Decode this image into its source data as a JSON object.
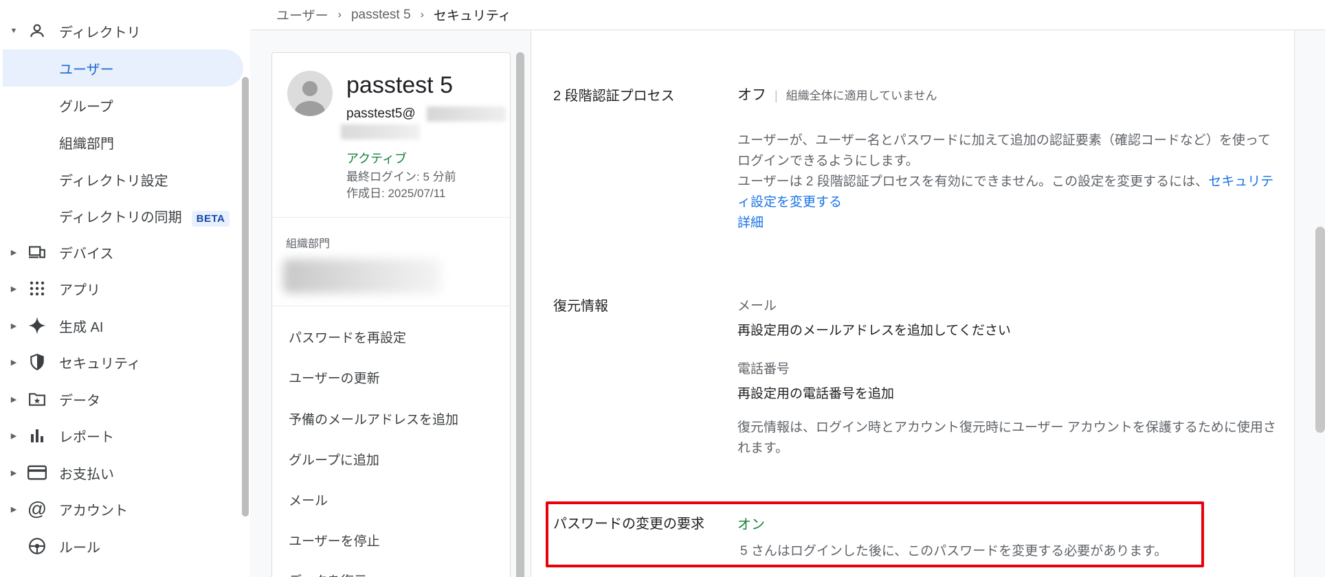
{
  "breadcrumb": {
    "items": [
      "ユーザー",
      "passtest 5",
      "セキュリティ"
    ]
  },
  "sidebar": {
    "directory": {
      "label": "ディレクトリ",
      "icon": "person-icon",
      "children": [
        {
          "label": "ユーザー",
          "active": true
        },
        {
          "label": "グループ"
        },
        {
          "label": "組織部門"
        },
        {
          "label": "ディレクトリ設定"
        },
        {
          "label": "ディレクトリの同期",
          "badge": "BETA"
        }
      ]
    },
    "items": [
      {
        "label": "デバイス",
        "icon": "devices-icon"
      },
      {
        "label": "アプリ",
        "icon": "apps-grid-icon"
      },
      {
        "label": "生成 AI",
        "icon": "sparkle-icon"
      },
      {
        "label": "セキュリティ",
        "icon": "shield-icon"
      },
      {
        "label": "データ",
        "icon": "folder-star-icon"
      },
      {
        "label": "レポート",
        "icon": "bar-chart-icon"
      },
      {
        "label": "お支払い",
        "icon": "credit-card-icon"
      },
      {
        "label": "アカウント",
        "icon": "at-sign-icon"
      },
      {
        "label": "ルール",
        "icon": "rules-icon"
      }
    ]
  },
  "user_card": {
    "name": "passtest 5",
    "email": "passtest5@",
    "status": "アクティブ",
    "last_login": "最終ログイン: 5 分前",
    "created": "作成日: 2025/07/11",
    "org_unit_label": "組織部門",
    "actions": [
      "パスワードを再設定",
      "ユーザーの更新",
      "予備のメールアドレスを追加",
      "グループに追加",
      "メール",
      "ユーザーを停止",
      "データを復元"
    ]
  },
  "security": {
    "two_step": {
      "label": "2 段階認証プロセス",
      "status": "オフ",
      "note": "組織全体に適用していません",
      "desc1": "ユーザーが、ユーザー名とパスワードに加えて追加の認証要素（確認コードなど）を使ってログインできるようにします。",
      "desc2": "ユーザーは 2 段階認証プロセスを有効にできません。この設定を変更するには、",
      "link_settings": "セキュリティ設定を変更する",
      "link_details": "詳細"
    },
    "recovery": {
      "label": "復元情報",
      "email_label": "メール",
      "email_value": "再設定用のメールアドレスを追加してください",
      "phone_label": "電話番号",
      "phone_value": "再設定用の電話番号を追加",
      "desc": "復元情報は、ログイン時とアカウント復元時にユーザー アカウントを保護するために使用されます。"
    },
    "password_change": {
      "label": "パスワードの変更の要求",
      "status": "オン",
      "desc": "5 さんはログインした後に、このパスワードを変更する必要があります。"
    }
  },
  "colors": {
    "accent": "#1a73e8",
    "active_bg": "#e8f0fe",
    "success": "#188038",
    "highlight": "#e8000b"
  }
}
